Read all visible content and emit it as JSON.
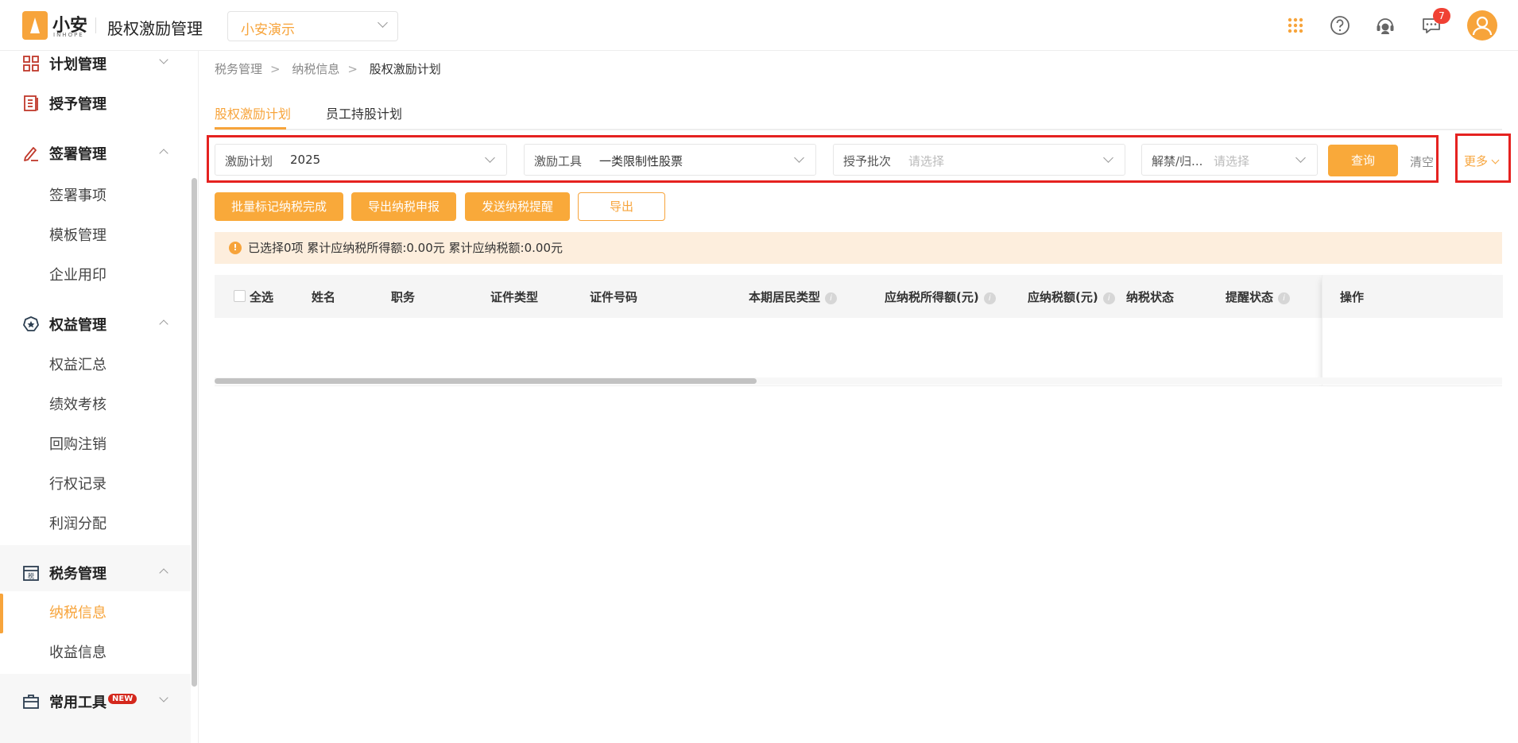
{
  "header": {
    "logo_text": "小安",
    "logo_sub": "INHOPE",
    "app_title": "股权激励管理",
    "company_select": "小安演示",
    "notification_count": "7",
    "icons": [
      "apps-grid-icon",
      "help-icon",
      "support-headset-icon",
      "message-icon",
      "user-avatar-icon"
    ],
    "accent_color": "#f7a43b"
  },
  "sidebar": {
    "items": [
      {
        "type": "group",
        "label": "计划管理",
        "icon": "plan-icon",
        "expanded": false
      },
      {
        "type": "group",
        "label": "授予管理",
        "icon": "grant-icon"
      },
      {
        "type": "group",
        "label": "签署管理",
        "icon": "sign-icon",
        "expanded": true
      },
      {
        "type": "sub",
        "label": "签署事项"
      },
      {
        "type": "sub",
        "label": "模板管理"
      },
      {
        "type": "sub",
        "label": "企业用印"
      },
      {
        "type": "group",
        "label": "权益管理",
        "icon": "equity-icon",
        "expanded": true
      },
      {
        "type": "sub",
        "label": "权益汇总"
      },
      {
        "type": "sub",
        "label": "绩效考核"
      },
      {
        "type": "sub",
        "label": "回购注销"
      },
      {
        "type": "sub",
        "label": "行权记录"
      },
      {
        "type": "sub",
        "label": "利润分配"
      },
      {
        "type": "group",
        "label": "税务管理",
        "icon": "tax-icon",
        "expanded": true
      },
      {
        "type": "sub",
        "label": "纳税信息",
        "active": true
      },
      {
        "type": "sub",
        "label": "收益信息"
      },
      {
        "type": "group",
        "label": "常用工具",
        "icon": "toolbox-icon",
        "tag": "NEW",
        "expanded": false
      }
    ]
  },
  "breadcrumb": [
    "税务管理",
    "纳税信息",
    "股权激励计划"
  ],
  "tabs": [
    {
      "label": "股权激励计划",
      "active": true
    },
    {
      "label": "员工持股计划",
      "active": false
    }
  ],
  "filters": {
    "plan": {
      "label": "激励计划",
      "value": "2025"
    },
    "tool": {
      "label": "激励工具",
      "value": "一类限制性股票"
    },
    "batch": {
      "label": "授予批次",
      "placeholder": "请选择"
    },
    "unlock": {
      "label": "解禁/归...",
      "placeholder": "请选择"
    },
    "query_label": "查询",
    "clear_label": "清空",
    "more_label": "更多"
  },
  "actions": {
    "batch_mark": "批量标记纳税完成",
    "export_declaration": "导出纳税申报",
    "send_reminder": "发送纳税提醒",
    "export": "导出"
  },
  "notice": {
    "text": "已选择0项 累计应纳税所得额:0.00元 累计应纳税额:0.00元"
  },
  "table": {
    "select_all": "全选",
    "columns": [
      "姓名",
      "职务",
      "证件类型",
      "证件号码",
      "本期居民类型",
      "应纳税所得额(元)",
      "应纳税额(元)",
      "纳税状态",
      "提醒状态",
      "操作"
    ],
    "rows": []
  }
}
